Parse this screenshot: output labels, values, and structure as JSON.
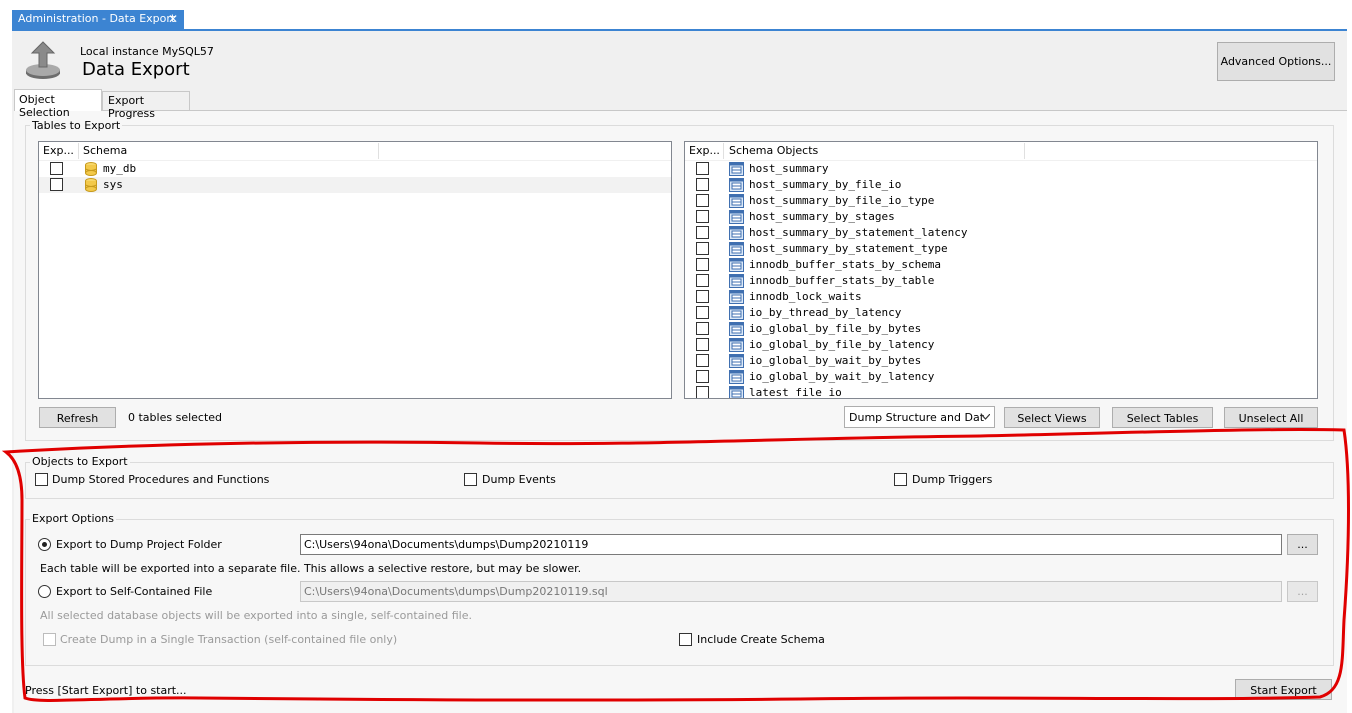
{
  "tab": {
    "title": "Administration - Data Export",
    "close": "✕"
  },
  "header": {
    "subtitle": "Local instance MySQL57",
    "title": "Data Export",
    "advanced_button": "Advanced Options..."
  },
  "tabs": [
    "Object Selection",
    "Export Progress"
  ],
  "tables_to_export": {
    "legend": "Tables to Export",
    "schema_list": {
      "headers": [
        "Exp...",
        "Schema"
      ],
      "rows": [
        "my_db",
        "sys"
      ]
    },
    "objects_list": {
      "headers": [
        "Exp...",
        "Schema Objects"
      ],
      "rows": [
        "host_summary",
        "host_summary_by_file_io",
        "host_summary_by_file_io_type",
        "host_summary_by_stages",
        "host_summary_by_statement_latency",
        "host_summary_by_statement_type",
        "innodb_buffer_stats_by_schema",
        "innodb_buffer_stats_by_table",
        "innodb_lock_waits",
        "io_by_thread_by_latency",
        "io_global_by_file_by_bytes",
        "io_global_by_file_by_latency",
        "io_global_by_wait_by_bytes",
        "io_global_by_wait_by_latency",
        "latest_file_io"
      ]
    },
    "refresh_button": "Refresh",
    "selected_count": "0 tables selected",
    "dump_select": "Dump Structure and Dat",
    "select_views_button": "Select Views",
    "select_tables_button": "Select Tables",
    "unselect_all_button": "Unselect All"
  },
  "objects_to_export": {
    "legend": "Objects to Export",
    "procedures": "Dump Stored Procedures and Functions",
    "events": "Dump Events",
    "triggers": "Dump Triggers"
  },
  "export_options": {
    "legend": "Export Options",
    "folder_radio": "Export to Dump Project Folder",
    "folder_path": "C:\\Users\\94ona\\Documents\\dumps\\Dump20210119",
    "browse": "...",
    "folder_note": "Each table will be exported into a separate file. This allows a selective restore, but may be slower.",
    "file_radio": "Export to Self-Contained File",
    "file_path": "C:\\Users\\94ona\\Documents\\dumps\\Dump20210119.sql",
    "file_note": "All selected database objects will be exported into a single, self-contained file.",
    "single_transaction": "Create Dump in a Single Transaction (self-contained file only)",
    "include_schema": "Include Create Schema"
  },
  "footer": {
    "status": "Press [Start Export] to start...",
    "start_button": "Start Export"
  },
  "colors": {
    "accent": "#3c84d2",
    "annotation": "#e00000"
  }
}
